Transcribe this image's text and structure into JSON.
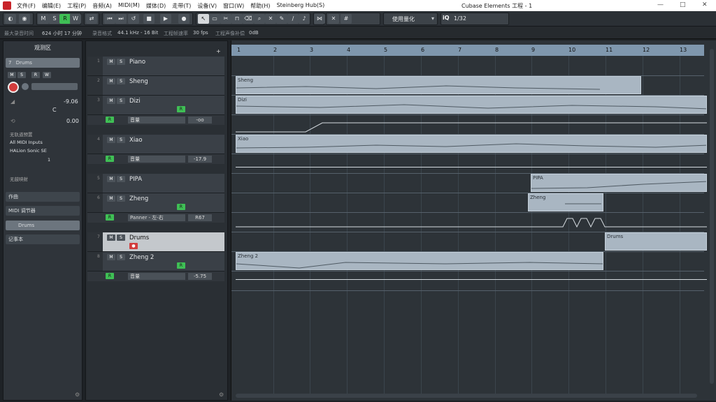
{
  "menu": [
    "文件(F)",
    "编辑(E)",
    "工程(P)",
    "音频(A)",
    "MIDI(M)",
    "媒体(D)",
    "走带(T)",
    "设备(V)",
    "窗口(W)",
    "帮助(H)",
    "Steinberg Hub(S)"
  ],
  "window_title": "Cubase Elements 工程 - 1",
  "toolbar": {
    "m": "M",
    "s": "S",
    "r": "R",
    "w": "W",
    "quantize": "使用量化",
    "quant_value": "1/32"
  },
  "info": {
    "rec_time_label": "最大录音时间",
    "rec_time": "624 小时 17 分钟",
    "format_label": "录音格式",
    "format": "44.1 kHz - 16 Bit",
    "fps_label": "工程帧速率",
    "fps": "30 fps",
    "pan_label": "工程声像补偿",
    "pan": "0dB"
  },
  "inspector": {
    "title": "观测区",
    "track": "Drums",
    "track_num": "7",
    "vol": "-9.06",
    "pan": "C",
    "delay": "0.00",
    "no_preset": "无轨道预置",
    "input": "All MIDI Inputs",
    "output": "HALion Sonic SE",
    "channel": "1",
    "no_map": "无鼓映射",
    "sec1": "作曲",
    "sec2": "MIDI 调节器",
    "sec3": "Drums",
    "sec4": "记事本"
  },
  "tracks": [
    {
      "num": "1",
      "name": "Piano"
    },
    {
      "num": "2",
      "name": "Sheng"
    },
    {
      "num": "3",
      "name": "Dizi"
    },
    {
      "num": "4",
      "name": "Xiao"
    },
    {
      "num": "5",
      "name": "PIPA"
    },
    {
      "num": "6",
      "name": "Zheng"
    },
    {
      "num": "7",
      "name": "Drums"
    },
    {
      "num": "8",
      "name": "Zheng 2"
    }
  ],
  "lanes": [
    {
      "p": "音量",
      "v": "-oo"
    },
    {
      "p": "音量",
      "v": "-17.9"
    },
    {
      "p": "Panner - 左-右",
      "v": "R67"
    },
    {
      "p": "音量",
      "v": "-5.75"
    }
  ],
  "bars": [
    "1",
    "2",
    "3",
    "4",
    "5",
    "6",
    "7",
    "8",
    "9",
    "10",
    "11",
    "12",
    "13"
  ],
  "parts": {
    "sheng": "Sheng",
    "dizi": "Dizi",
    "xiao": "Xiao",
    "pipa": "PIPA",
    "zheng": "Zheng",
    "drums": "Drums",
    "zheng2": "Zheng 2"
  },
  "colors": {
    "accent": "#3fbf55",
    "ruler": "#7f97ad",
    "part": "#a9b6c2",
    "record": "#d23c3c"
  }
}
